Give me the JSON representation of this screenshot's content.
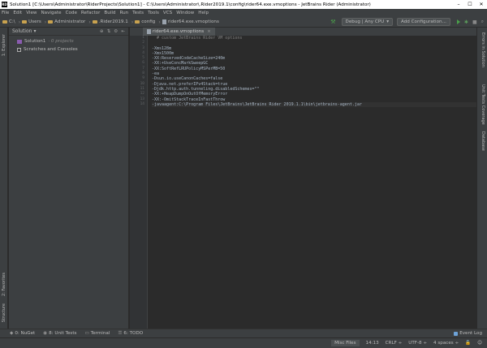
{
  "title": "Solution1 [C:\\Users\\Administrator\\RiderProjects\\Solution1] - C:\\Users\\Administrator\\.Rider2019.1\\config\\rider64.exe.vmoptions - JetBrains Rider (Administrator)",
  "menu": [
    "File",
    "Edit",
    "View",
    "Navigate",
    "Code",
    "Refactor",
    "Build",
    "Run",
    "Tests",
    "Tools",
    "VCS",
    "Window",
    "Help"
  ],
  "breadcrumbs": [
    "C:\\",
    "Users",
    "Administrator",
    ".Rider2019.1",
    "config",
    "rider64.exe.vmoptions"
  ],
  "toolbar": {
    "config": "Debug | Any CPU",
    "add_config": "Add Configuration..."
  },
  "left_strip": {
    "explorer": "1: Explorer",
    "favorites": "2: Favorites",
    "structure": "Structure"
  },
  "right_strip": {
    "errors": "Errors in Solution",
    "unit_coverage": "Unit Tests Coverage",
    "database": "Database"
  },
  "explorer": {
    "header": "Solution",
    "items": [
      {
        "label": "Solution1",
        "note": "· 0 projects"
      },
      {
        "label": "Scratches and Consoles",
        "note": ""
      }
    ]
  },
  "editor": {
    "tab": "rider64.exe.vmoptions",
    "lines": [
      {
        "n": "1",
        "text": "  # custom JetBrains Rider VM options"
      },
      {
        "n": "2",
        "text": ""
      },
      {
        "n": "3",
        "text": "-Xms128m"
      },
      {
        "n": "4",
        "text": "-Xmx1500m"
      },
      {
        "n": "5",
        "text": "-XX:ReservedCodeCacheSize=240m"
      },
      {
        "n": "6",
        "text": "-XX:+UseConcMarkSweepGC"
      },
      {
        "n": "7",
        "text": "-XX:SoftRefLRUPolicyMSPerMB=50"
      },
      {
        "n": "8",
        "text": "-ea"
      },
      {
        "n": "9",
        "text": "-Dsun.io.useCanonCaches=false"
      },
      {
        "n": "10",
        "text": "-Djava.net.preferIPv4Stack=true"
      },
      {
        "n": "11",
        "text": "-Djdk.http.auth.tunneling.disabledSchemes=\"\""
      },
      {
        "n": "12",
        "text": "-XX:+HeapDumpOnOutOfMemoryError"
      },
      {
        "n": "13",
        "text": "-XX:-OmitStackTraceInFastThrow"
      },
      {
        "n": "14",
        "text": "-javaagent:C:\\Program Files\\JetBrains\\JetBrains Rider 2019.1.1\\bin\\jetbrains-agent.jar"
      }
    ]
  },
  "bottom_tabs": [
    {
      "icon": "nuget-icon",
      "label": "0: NuGet"
    },
    {
      "icon": "unit-tests-icon",
      "label": "8: Unit Tests"
    },
    {
      "icon": "terminal-icon",
      "label": "Terminal"
    },
    {
      "icon": "todo-icon",
      "label": "6: TODO"
    }
  ],
  "event_log": "Event Log",
  "status": {
    "misc": "Misc Files",
    "position": "14:13",
    "line_sep": "CRLF ÷",
    "encoding": "UTF-8 ÷",
    "indent": "4 spaces ÷"
  }
}
